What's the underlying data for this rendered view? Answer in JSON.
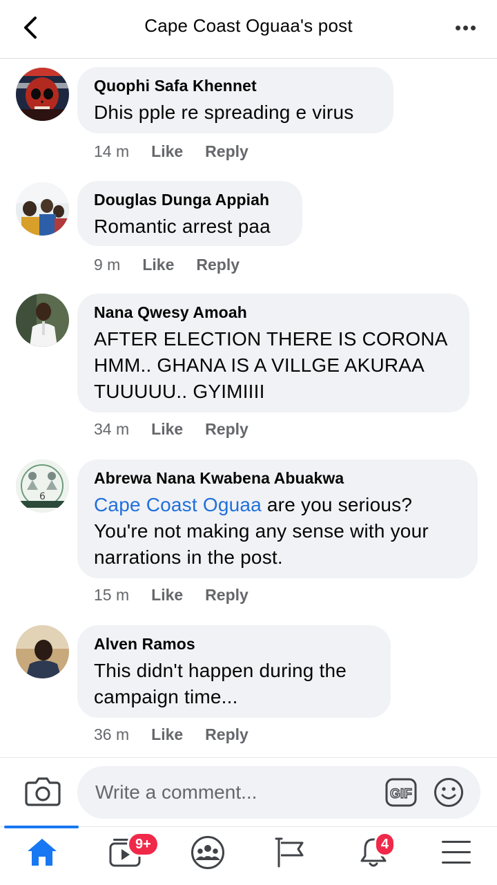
{
  "header": {
    "title": "Cape Coast Oguaa's post"
  },
  "comments": [
    {
      "author": "Quophi Safa Khennet",
      "text": "Dhis pple re spreading e virus",
      "time": "14 m",
      "like": "Like",
      "reply": "Reply"
    },
    {
      "author": "Douglas Dunga Appiah",
      "text": "Romantic arrest paa",
      "time": "9 m",
      "like": "Like",
      "reply": "Reply"
    },
    {
      "author": "Nana Qwesy Amoah",
      "text_lines": [
        "AFTER ELECTION THERE IS CORONA",
        "HMM.. GHANA IS A VILLGE AKURAA",
        "TUUUUU.. GYIMIIII"
      ],
      "time": "34 m",
      "like": "Like",
      "reply": "Reply"
    },
    {
      "author": "Abrewa Nana Kwabena Abuakwa",
      "mention": "Cape Coast Oguaa",
      "text_after_mention": " are you serious?",
      "text_lines": [
        "You're not making any sense with your",
        "narrations in the post."
      ],
      "time": "15 m",
      "like": "Like",
      "reply": "Reply"
    },
    {
      "author": "Alven Ramos",
      "text_lines": [
        "This didn't happen during the",
        "campaign time..."
      ],
      "time": "36 m",
      "like": "Like",
      "reply": "Reply"
    }
  ],
  "composer": {
    "placeholder": "Write a comment...",
    "gif_label": "GIF"
  },
  "nav": {
    "video_badge": "9+",
    "notifications_badge": "4",
    "accent": "#1877f2",
    "badge_color": "#f02849"
  }
}
